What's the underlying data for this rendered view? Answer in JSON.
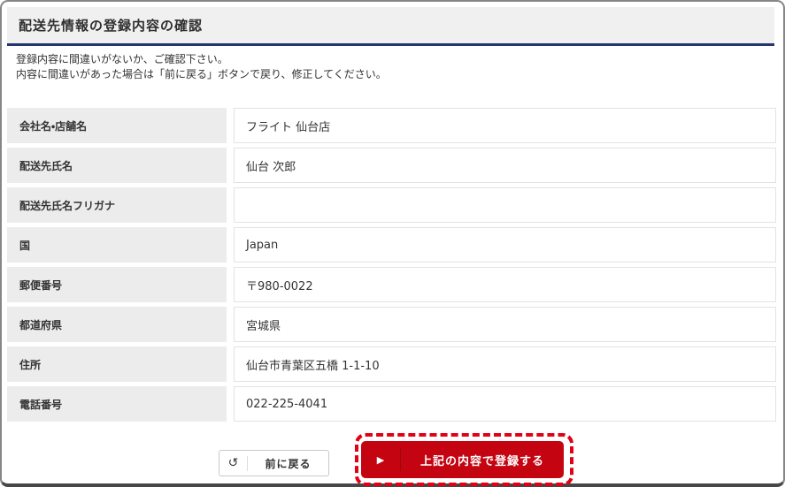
{
  "page": {
    "title": "配送先情報の登録内容の確認",
    "instruction_line1": "登録内容に間違いがないか、ご確認下さい。",
    "instruction_line2": "内容に間違いがあった場合は「前に戻る」ボタンで戻り、修正してください。"
  },
  "form": {
    "rows": [
      {
        "label": "会社名・店舗名",
        "value": "フライト 仙台店"
      },
      {
        "label": "配送先氏名",
        "value": "仙台 次郎"
      },
      {
        "label": "配送先氏名フリガナ",
        "value": ""
      },
      {
        "label": "国",
        "value": "Japan"
      },
      {
        "label": "郵便番号",
        "value": "〒980-0022"
      },
      {
        "label": "都道府県",
        "value": "宮城県"
      },
      {
        "label": "住所",
        "value": "仙台市青葉区五橋 1-1-10"
      },
      {
        "label": "電話番号",
        "value": "022-225-4041"
      }
    ]
  },
  "buttons": {
    "back": {
      "label": "前に戻る",
      "icon": "↺"
    },
    "submit": {
      "label": "上記の内容で登録する",
      "icon": "▶"
    }
  },
  "colors": {
    "title_rule_navy": "#23376e",
    "label_cell_gray": "#ececec",
    "submit_red": "#c40410",
    "highlight_dashed_red": "#e20016"
  }
}
